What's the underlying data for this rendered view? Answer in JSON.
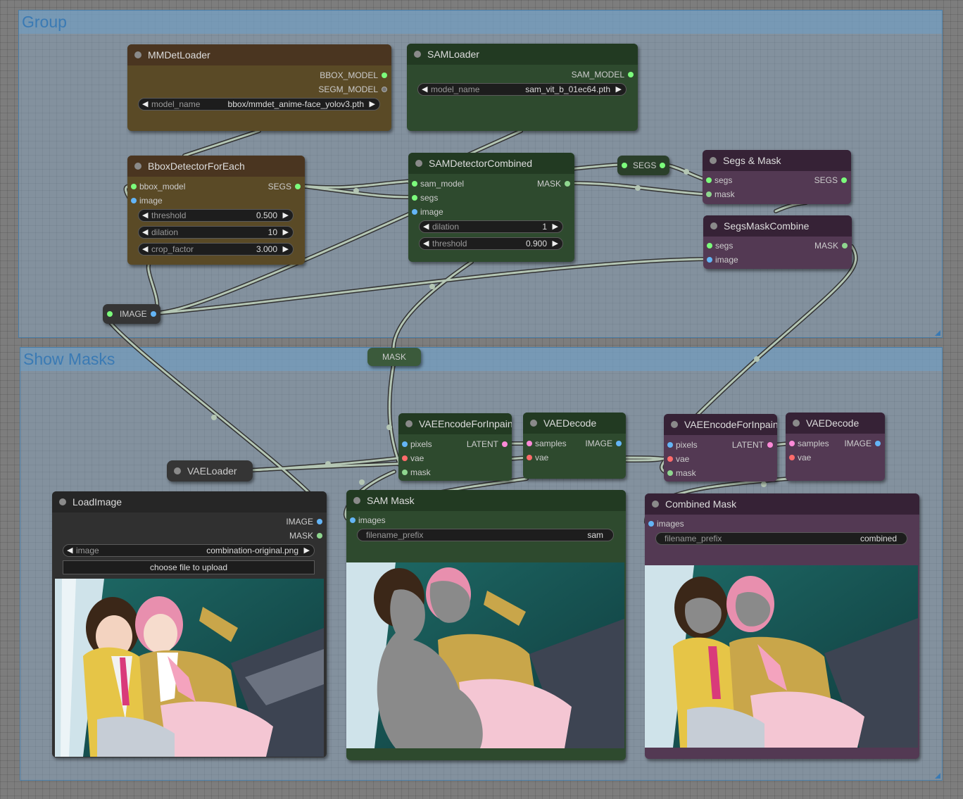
{
  "groups": {
    "group_top": "Group",
    "group_bottom": "Show Masks"
  },
  "nodes": {
    "mmdet_loader": {
      "title": "MMDetLoader",
      "outputs": [
        "BBOX_MODEL",
        "SEGM_MODEL"
      ],
      "model_name_label": "model_name",
      "model_name_value": "bbox/mmdet_anime-face_yolov3.pth"
    },
    "sam_loader": {
      "title": "SAMLoader",
      "output": "SAM_MODEL",
      "model_name_label": "model_name",
      "model_name_value": "sam_vit_b_01ec64.pth"
    },
    "bbox_detector": {
      "title": "BboxDetectorForEach",
      "inputs": [
        "bbox_model",
        "image"
      ],
      "output": "SEGS",
      "threshold_label": "threshold",
      "threshold_value": "0.500",
      "dilation_label": "dilation",
      "dilation_value": "10",
      "crop_factor_label": "crop_factor",
      "crop_factor_value": "3.000"
    },
    "sam_detector": {
      "title": "SAMDetectorCombined",
      "inputs": [
        "sam_model",
        "segs",
        "image"
      ],
      "output": "MASK",
      "dilation_label": "dilation",
      "dilation_value": "1",
      "threshold_label": "threshold",
      "threshold_value": "0.900"
    },
    "segs_reroute": {
      "label": "SEGS"
    },
    "segs_mask": {
      "title": "Segs & Mask",
      "inputs": [
        "segs",
        "mask"
      ],
      "output": "SEGS"
    },
    "segs_mask_combine": {
      "title": "SegsMaskCombine",
      "inputs": [
        "segs",
        "image"
      ],
      "output": "MASK"
    },
    "image_reroute": {
      "label": "IMAGE"
    },
    "mask_reroute": {
      "label": "MASK"
    },
    "vae_encode_1": {
      "title": "VAEEncodeForInpaint",
      "inputs": [
        "pixels",
        "vae",
        "mask"
      ],
      "output": "LATENT"
    },
    "vae_decode_1": {
      "title": "VAEDecode",
      "inputs": [
        "samples",
        "vae"
      ],
      "output": "IMAGE"
    },
    "vae_encode_2": {
      "title": "VAEEncodeForInpaint",
      "inputs": [
        "pixels",
        "vae",
        "mask"
      ],
      "output": "LATENT"
    },
    "vae_decode_2": {
      "title": "VAEDecode",
      "inputs": [
        "samples",
        "vae"
      ],
      "output": "IMAGE"
    },
    "vae_loader": {
      "title": "VAELoader"
    },
    "load_image": {
      "title": "LoadImage",
      "outputs": [
        "IMAGE",
        "MASK"
      ],
      "image_label": "image",
      "image_value": "combination-original.png",
      "upload_label": "choose file to upload"
    },
    "sam_mask": {
      "title": "SAM Mask",
      "input": "images",
      "prefix_label": "filename_prefix",
      "prefix_value": "sam"
    },
    "combined_mask": {
      "title": "Combined Mask",
      "input": "images",
      "prefix_label": "filename_prefix",
      "prefix_value": "combined"
    }
  },
  "colors": {
    "group_fill": "#8cafcd",
    "group_title": "#3a7ab4",
    "link": "#9fb39f",
    "brown_node": "#5a4a26",
    "green_node": "#2e4a2e",
    "purple_node": "#533953",
    "slot_green": "#7cfc7c",
    "slot_blue": "#64b5f6",
    "slot_red": "#ff6b6b",
    "slot_pink": "#ff8ad8"
  }
}
